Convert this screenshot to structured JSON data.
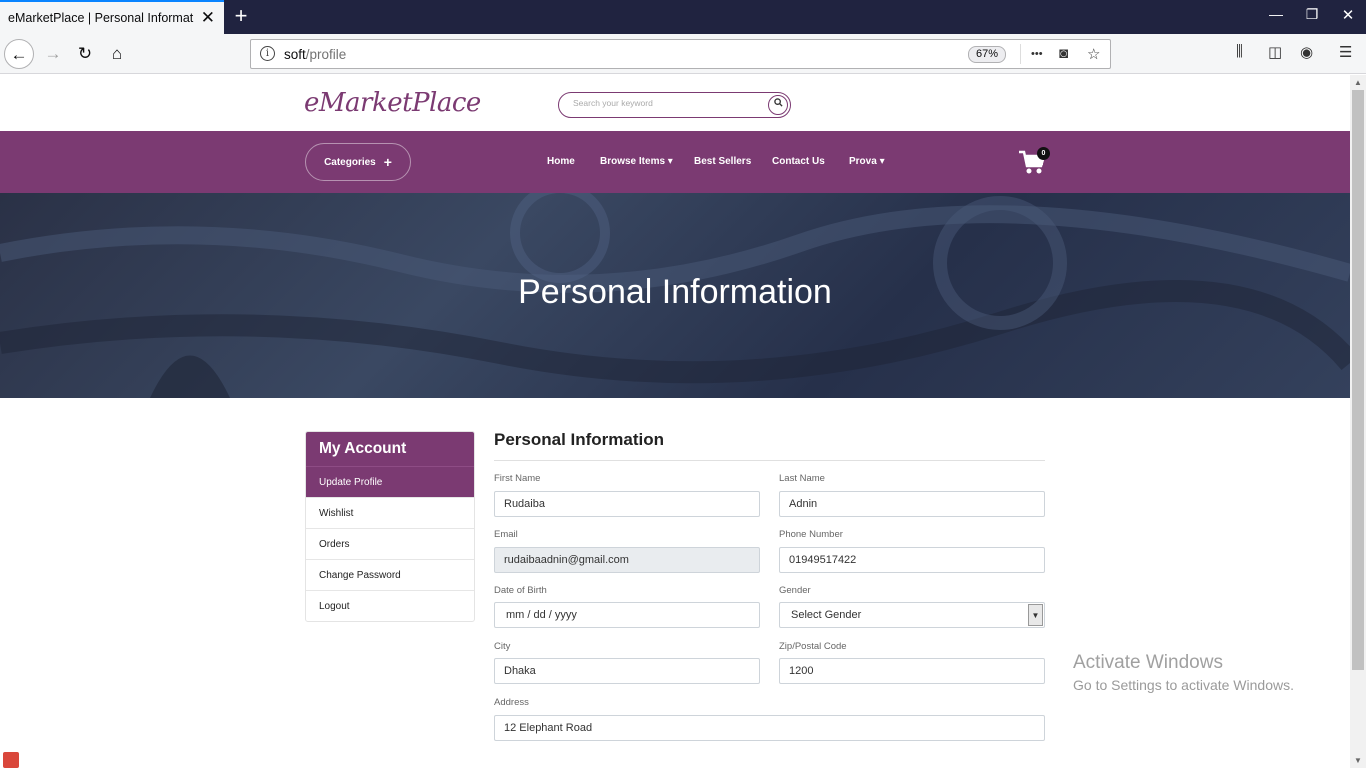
{
  "browser": {
    "tab_title": "eMarketPlace | Personal Information",
    "tab_close": "✕",
    "new_tab": "+",
    "url_host": "soft",
    "url_path": "/profile",
    "zoom": "67%",
    "url_more": "•••"
  },
  "site": {
    "logo": "eMarketPlace",
    "search_placeholder": "Search your keyword",
    "categories_label": "Categories",
    "menu": [
      "Home",
      "Browse Items ▾",
      "Best Sellers",
      "Contact Us",
      "Prova ▾"
    ],
    "cart_count": "0",
    "hero_title": "Personal Information"
  },
  "sidebar": {
    "heading": "My Account",
    "items": [
      "Update Profile",
      "Wishlist",
      "Orders",
      "Change Password",
      "Logout"
    ]
  },
  "form": {
    "title": "Personal Information",
    "first_name_label": "First Name",
    "first_name": "Rudaiba",
    "last_name_label": "Last Name",
    "last_name": "Adnin",
    "email_label": "Email",
    "email": "rudaibaadnin@gmail.com",
    "phone_label": "Phone Number",
    "phone": "01949517422",
    "dob_label": "Date of Birth",
    "dob": "mm / dd / yyyy",
    "gender_label": "Gender",
    "gender": "Select Gender",
    "city_label": "City",
    "city": "Dhaka",
    "zip_label": "Zip/Postal Code",
    "zip": "1200",
    "address_label": "Address",
    "address": "12 Elephant Road"
  },
  "watermark": {
    "line1": "Activate Windows",
    "line2": "Go to Settings to activate Windows."
  },
  "colors": {
    "brand": "#7b3a72",
    "browser_dark": "#202340"
  }
}
